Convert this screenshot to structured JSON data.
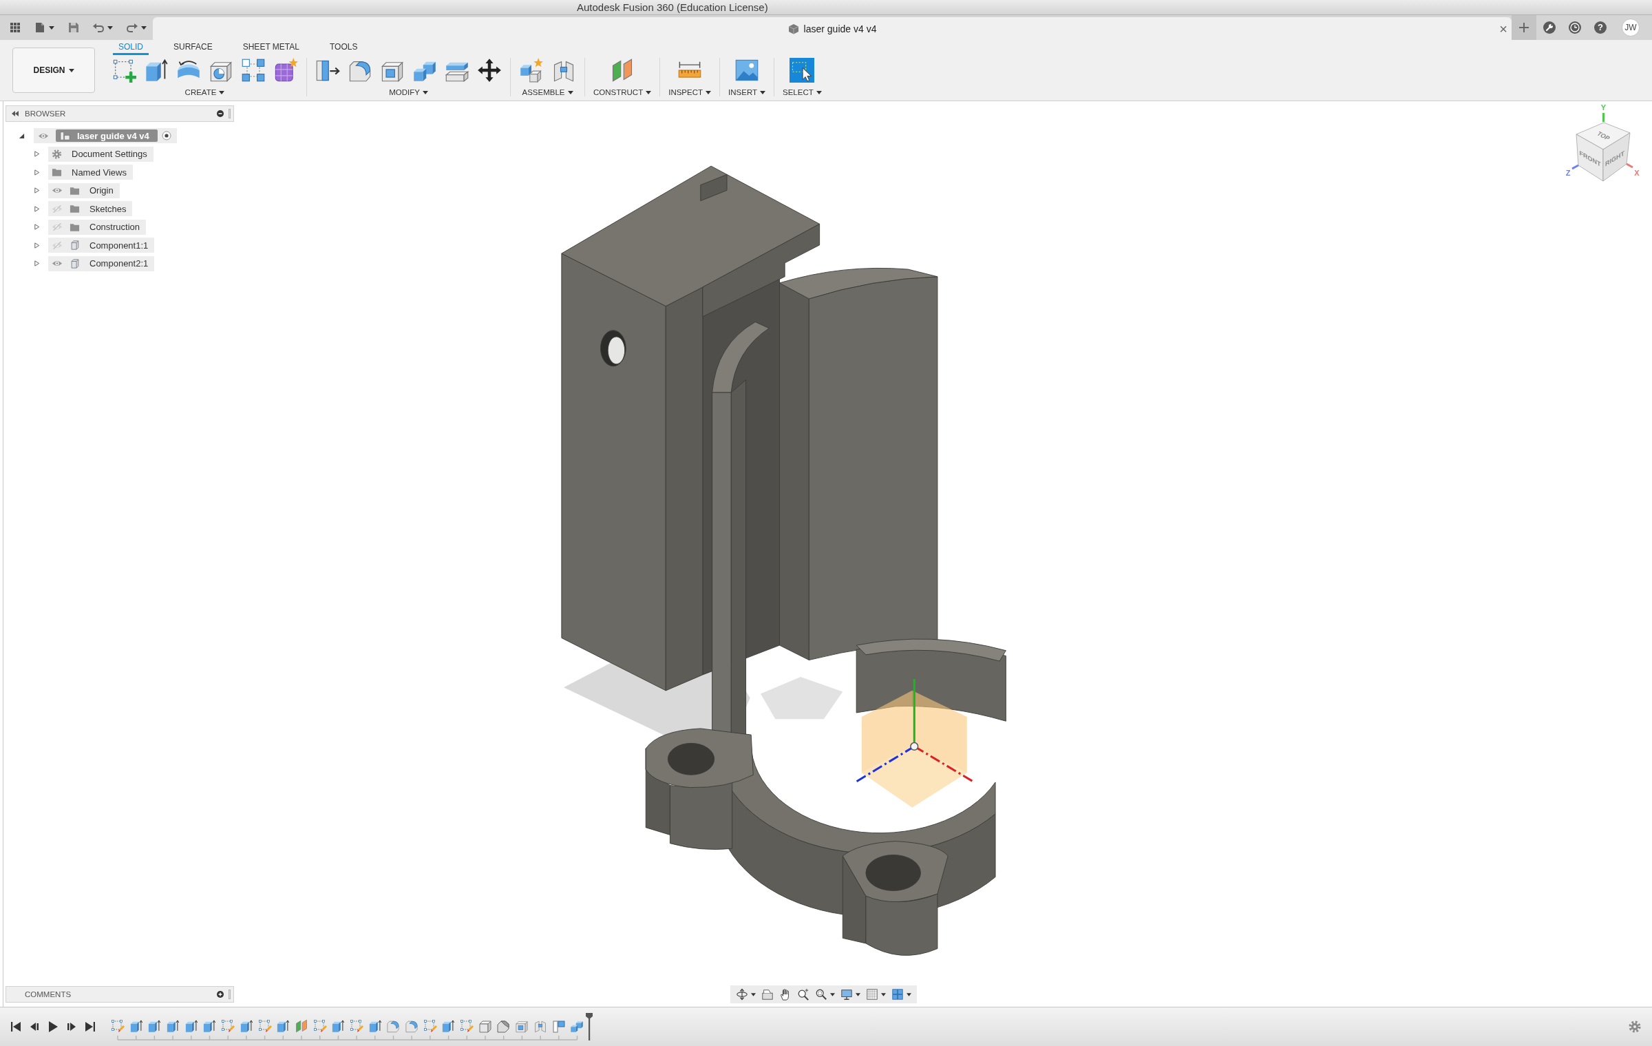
{
  "window": {
    "title": "Autodesk Fusion 360 (Education License)"
  },
  "document_tab": {
    "title": "laser guide v4 v4",
    "close": "×"
  },
  "top_bar": {
    "help": "?",
    "user_initials": "JW"
  },
  "workspace": {
    "label": "DESIGN"
  },
  "ribbon_tabs": [
    {
      "label": "SOLID",
      "selected": true
    },
    {
      "label": "SURFACE",
      "selected": false
    },
    {
      "label": "SHEET METAL",
      "selected": false
    },
    {
      "label": "TOOLS",
      "selected": false
    }
  ],
  "tool_groups": [
    {
      "label": "CREATE",
      "tools": [
        {
          "kind": "sketch"
        },
        {
          "kind": "extrude"
        },
        {
          "kind": "revolve"
        },
        {
          "kind": "hole"
        },
        {
          "kind": "pattern"
        },
        {
          "kind": "form"
        }
      ]
    },
    {
      "label": "MODIFY",
      "tools": [
        {
          "kind": "presspull"
        },
        {
          "kind": "fillet"
        },
        {
          "kind": "shell"
        },
        {
          "kind": "combine"
        },
        {
          "kind": "offset"
        },
        {
          "kind": "move"
        }
      ]
    },
    {
      "label": "ASSEMBLE",
      "tools": [
        {
          "kind": "component"
        },
        {
          "kind": "joint"
        }
      ]
    },
    {
      "label": "CONSTRUCT",
      "tools": [
        {
          "kind": "plane"
        }
      ]
    },
    {
      "label": "INSPECT",
      "tools": [
        {
          "kind": "measure"
        }
      ]
    },
    {
      "label": "INSERT",
      "tools": [
        {
          "kind": "image"
        }
      ]
    },
    {
      "label": "SELECT",
      "tools": [
        {
          "kind": "select"
        }
      ]
    }
  ],
  "browser": {
    "title": "BROWSER",
    "root": {
      "label": "laser guide v4 v4",
      "expanded": true,
      "visible": true,
      "active": true,
      "children": [
        {
          "label": "Document Settings",
          "kind": "settings",
          "expanded": false
        },
        {
          "label": "Named Views",
          "kind": "folder",
          "expanded": false
        },
        {
          "label": "Origin",
          "kind": "folder",
          "expanded": false,
          "visible": true
        },
        {
          "label": "Sketches",
          "kind": "folder",
          "expanded": false,
          "visible": false
        },
        {
          "label": "Construction",
          "kind": "folder",
          "expanded": false,
          "visible": false
        },
        {
          "label": "Component1:1",
          "kind": "component",
          "expanded": false,
          "visible": false
        },
        {
          "label": "Component2:1",
          "kind": "component",
          "expanded": false,
          "visible": true
        }
      ]
    }
  },
  "comments": {
    "title": "COMMENTS"
  },
  "viewcube": {
    "faces": [
      {
        "kind": "top",
        "label": "TOP"
      },
      {
        "kind": "front",
        "label": "FRONT"
      },
      {
        "kind": "right",
        "label": "RIGHT"
      }
    ],
    "axes": [
      {
        "kind": "y",
        "label": "Y",
        "color": "#4fc84f"
      },
      {
        "kind": "z",
        "label": "Z",
        "color": "#6d7ff2"
      },
      {
        "kind": "x",
        "label": "X",
        "color": "#f07575"
      }
    ]
  },
  "timeline": {
    "features": [
      {
        "kind": "sketch"
      },
      {
        "kind": "extrude"
      },
      {
        "kind": "extrude"
      },
      {
        "kind": "extrude"
      },
      {
        "kind": "extrude"
      },
      {
        "kind": "extrude"
      },
      {
        "kind": "sketch"
      },
      {
        "kind": "extrude"
      },
      {
        "kind": "sketch"
      },
      {
        "kind": "extrude"
      },
      {
        "kind": "plane"
      },
      {
        "kind": "sketch"
      },
      {
        "kind": "extrude"
      },
      {
        "kind": "sketch"
      },
      {
        "kind": "extrude"
      },
      {
        "kind": "fillet"
      },
      {
        "kind": "fillet"
      },
      {
        "kind": "sketch"
      },
      {
        "kind": "extrude"
      },
      {
        "kind": "sketch"
      },
      {
        "kind": "box"
      },
      {
        "kind": "bevel"
      },
      {
        "kind": "shell"
      },
      {
        "kind": "joint"
      },
      {
        "kind": "split"
      },
      {
        "kind": "combine"
      }
    ]
  }
}
